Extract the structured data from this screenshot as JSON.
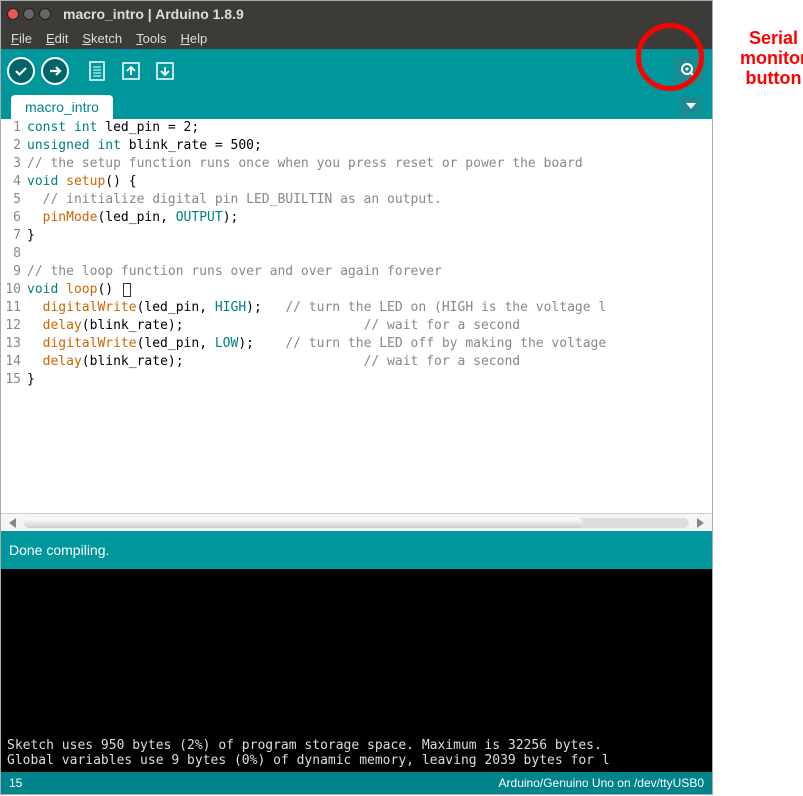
{
  "titlebar": {
    "title": "macro_intro | Arduino 1.8.9"
  },
  "menu": {
    "file": "File",
    "edit": "Edit",
    "sketch": "Sketch",
    "tools": "Tools",
    "help": "Help"
  },
  "tab": {
    "name": "macro_intro"
  },
  "code": {
    "lines": [
      {
        "n": "1",
        "html": "<span class='kw'>const</span> <span class='kw'>int</span> led_pin = 2;"
      },
      {
        "n": "2",
        "html": "<span class='kw'>unsigned</span> <span class='kw'>int</span> blink_rate = 500;"
      },
      {
        "n": "3",
        "html": "<span class='cmt'>// the setup function runs once when you press reset or power the board</span>"
      },
      {
        "n": "4",
        "html": "<span class='kw'>void</span> <span class='fn'>setup</span>() {"
      },
      {
        "n": "5",
        "html": "  <span class='cmt'>// initialize digital pin LED_BUILTIN as an output.</span>"
      },
      {
        "n": "6",
        "html": "  <span class='fn'>pinMode</span>(led_pin, <span class='const'>OUTPUT</span>);"
      },
      {
        "n": "7",
        "html": "}"
      },
      {
        "n": "8",
        "html": ""
      },
      {
        "n": "9",
        "html": "<span class='cmt'>// the loop function runs over and over again forever</span>"
      },
      {
        "n": "10",
        "html": "<span class='kw'>void</span> <span class='fn'>loop</span>() <span class='cursor-box'></span>"
      },
      {
        "n": "11",
        "html": "  <span class='fn'>digitalWrite</span>(led_pin, <span class='const'>HIGH</span>);   <span class='cmt'>// turn the LED on (HIGH is the voltage l</span>"
      },
      {
        "n": "12",
        "html": "  <span class='fn'>delay</span>(blink_rate);                       <span class='cmt'>// wait for a second</span>"
      },
      {
        "n": "13",
        "html": "  <span class='fn'>digitalWrite</span>(led_pin, <span class='const'>LOW</span>);    <span class='cmt'>// turn the LED off by making the voltage</span>"
      },
      {
        "n": "14",
        "html": "  <span class='fn'>delay</span>(blink_rate);                       <span class='cmt'>// wait for a second</span>"
      },
      {
        "n": "15",
        "html": "}"
      }
    ]
  },
  "status": {
    "compile": "Done compiling."
  },
  "console": {
    "l1": "Sketch uses 950 bytes (2%) of program storage space. Maximum is 32256 bytes.",
    "l2": "Global variables use 9 bytes (0%) of dynamic memory, leaving 2039 bytes for l"
  },
  "footer": {
    "line": "15",
    "board": "Arduino/Genuino Uno on /dev/ttyUSB0"
  },
  "annot": {
    "t1": "Serial",
    "t2": "monitor",
    "t3": "button"
  }
}
